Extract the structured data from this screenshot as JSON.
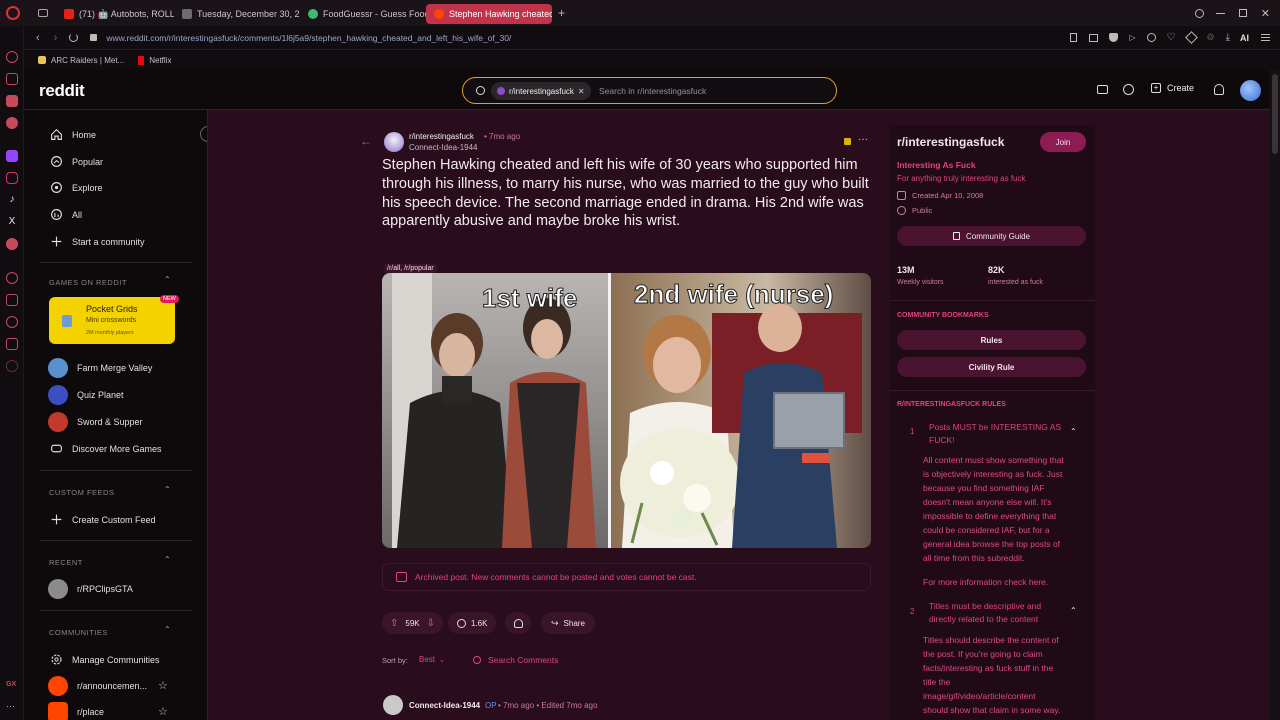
{
  "browser": {
    "tabs": [
      {
        "label": "(71) 🤖 Autobots, ROLL O",
        "fav": "#e62117"
      },
      {
        "label": "Tuesday, December 30, 2",
        "fav": "#6f6a6d"
      },
      {
        "label": "FoodGuessr - Guess Food",
        "fav": "#3fba72"
      },
      {
        "label": "Stephen Hawking cheated",
        "fav": "#ff4500"
      }
    ],
    "url": "www.reddit.com/r/interestingasfuck/comments/1l6j5a9/stephen_hawking_cheated_and_left_his_wife_of_30/",
    "ai_label": "AI",
    "bookmarks": [
      {
        "label": "ARC Raiders | Met...",
        "color": "#e8c35a"
      },
      {
        "label": "Netflix",
        "color": "#e50914"
      }
    ]
  },
  "header": {
    "logo": "reddit",
    "search_chip": "r/interestingasfuck",
    "search_placeholder": "Search in r/interestingasfuck",
    "create_label": "Create"
  },
  "nav": {
    "items": [
      {
        "label": "Home",
        "icon": "home-icon"
      },
      {
        "label": "Popular",
        "icon": "popular-icon"
      },
      {
        "label": "Explore",
        "icon": "explore-icon"
      },
      {
        "label": "All",
        "icon": "all-icon"
      },
      {
        "label": "Start a community",
        "icon": "plus-icon"
      }
    ],
    "games_heading": "GAMES ON REDDIT",
    "featured_game": {
      "title": "Pocket Grids",
      "subtitle": "Mini crosswords",
      "meta": "2M monthly players",
      "badge": "NEW"
    },
    "games": [
      {
        "label": "Farm Merge Valley",
        "color": "#5a8fd0"
      },
      {
        "label": "Quiz Planet",
        "color": "#3b4fc0"
      },
      {
        "label": "Sword & Supper",
        "color": "#c0392b"
      },
      {
        "label": "Discover More Games",
        "color": ""
      }
    ],
    "custom_heading": "CUSTOM FEEDS",
    "create_feed": "Create Custom Feed",
    "recent_heading": "RECENT",
    "recent": [
      {
        "label": "r/RPClipsGTA"
      }
    ],
    "communities_heading": "COMMUNITIES",
    "communities": [
      {
        "label": "Manage Communities"
      },
      {
        "label": "r/announcemen..."
      },
      {
        "label": "r/place"
      }
    ]
  },
  "post": {
    "subreddit": "r/interestingasfuck",
    "age": "• 7mo ago",
    "author": "Connect-Idea-1944",
    "title": "Stephen Hawking cheated and left his wife of 30 years who supported him through his illness, to marry his nurse, who was married to the guy who built his speech device. The second marriage ended in drama. His 2nd wife was apparently abusive and maybe broke his wrist.",
    "flair": "/r/all, /r/popular",
    "image_caption_left": "1st wife",
    "image_caption_right": "2nd wife (nurse)",
    "archived": "Archived post. New comments cannot be posted and votes cannot be cast.",
    "votes": "59K",
    "comments": "1.6K",
    "share": "Share",
    "sort_label": "Sort by:",
    "sort_value": "Best",
    "search_comments": "Search Comments",
    "comment_author": "Connect-Idea-1944",
    "comment_op": "OP",
    "comment_meta": "• 7mo ago • Edited 7mo ago"
  },
  "sidebar": {
    "name": "r/interestingasfuck",
    "join": "Join",
    "title": "Interesting As Fuck",
    "desc": "For anything truly interesting as fuck",
    "created": "Created Apr 10, 2008",
    "visibility": "Public",
    "guide": "Community Guide",
    "stats": [
      {
        "value": "13M",
        "label": "Weekly visitors"
      },
      {
        "value": "82K",
        "label": "interested as fuck"
      }
    ],
    "bookmarks_heading": "COMMUNITY BOOKMARKS",
    "bookmarks": [
      "Rules",
      "Civility Rule"
    ],
    "rules_heading": "R/INTERESTINGASFUCK RULES",
    "rule1_num": "1",
    "rule1_title": "Posts MUST be INTERESTING AS FUCK!",
    "rule1_lines": [
      "All content must show something that",
      "is objectively interesting as fuck. Just",
      "because you find something IAF",
      "doesn't mean anyone else will. It's",
      "impossible to define everything that",
      "could be considered IAF, but for a",
      "general idea browse the top posts of",
      "all time from this subreddit."
    ],
    "rule1_more": "For more information check here.",
    "rule2_num": "2",
    "rule2_title": "Titles must be descriptive and directly related to the content",
    "rule2_lines": [
      "Titles should describe the content of",
      "the post. If you're going to claim",
      "facts/interesting as fuck stuff in the",
      "title the",
      "image/gif/video/article/content",
      "should show that claim in some way."
    ]
  },
  "colors": {
    "accent": "#e1457f",
    "brand": "#ff4500",
    "page_bg": "#2a0d1c"
  }
}
